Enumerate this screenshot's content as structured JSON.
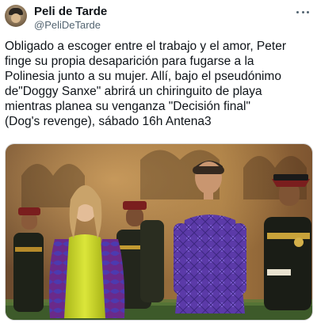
{
  "author": {
    "display_name": "Peli de Tarde",
    "handle": "@PeliDeTarde"
  },
  "icons": {
    "more": "more-horizontal-icon"
  },
  "tweet": {
    "text": "Obligado a escoger entre el trabajo y el amor, Peter\nfinge su propia desaparición para fugarse a la\nPolinesia junto a su mujer. Allí, bajo el pseudónimo\nde\"Doggy Sanxe\" abrirá un chiringuito de playa\nmientras planea su venganza \"Decisión final\"\n(Dog's revenge), sábado 16h Antena3"
  },
  "colors": {
    "text": "#0f1419",
    "secondary": "#536471",
    "dress": "#c9d62a",
    "purple_shirt": "#5a3aa6"
  }
}
